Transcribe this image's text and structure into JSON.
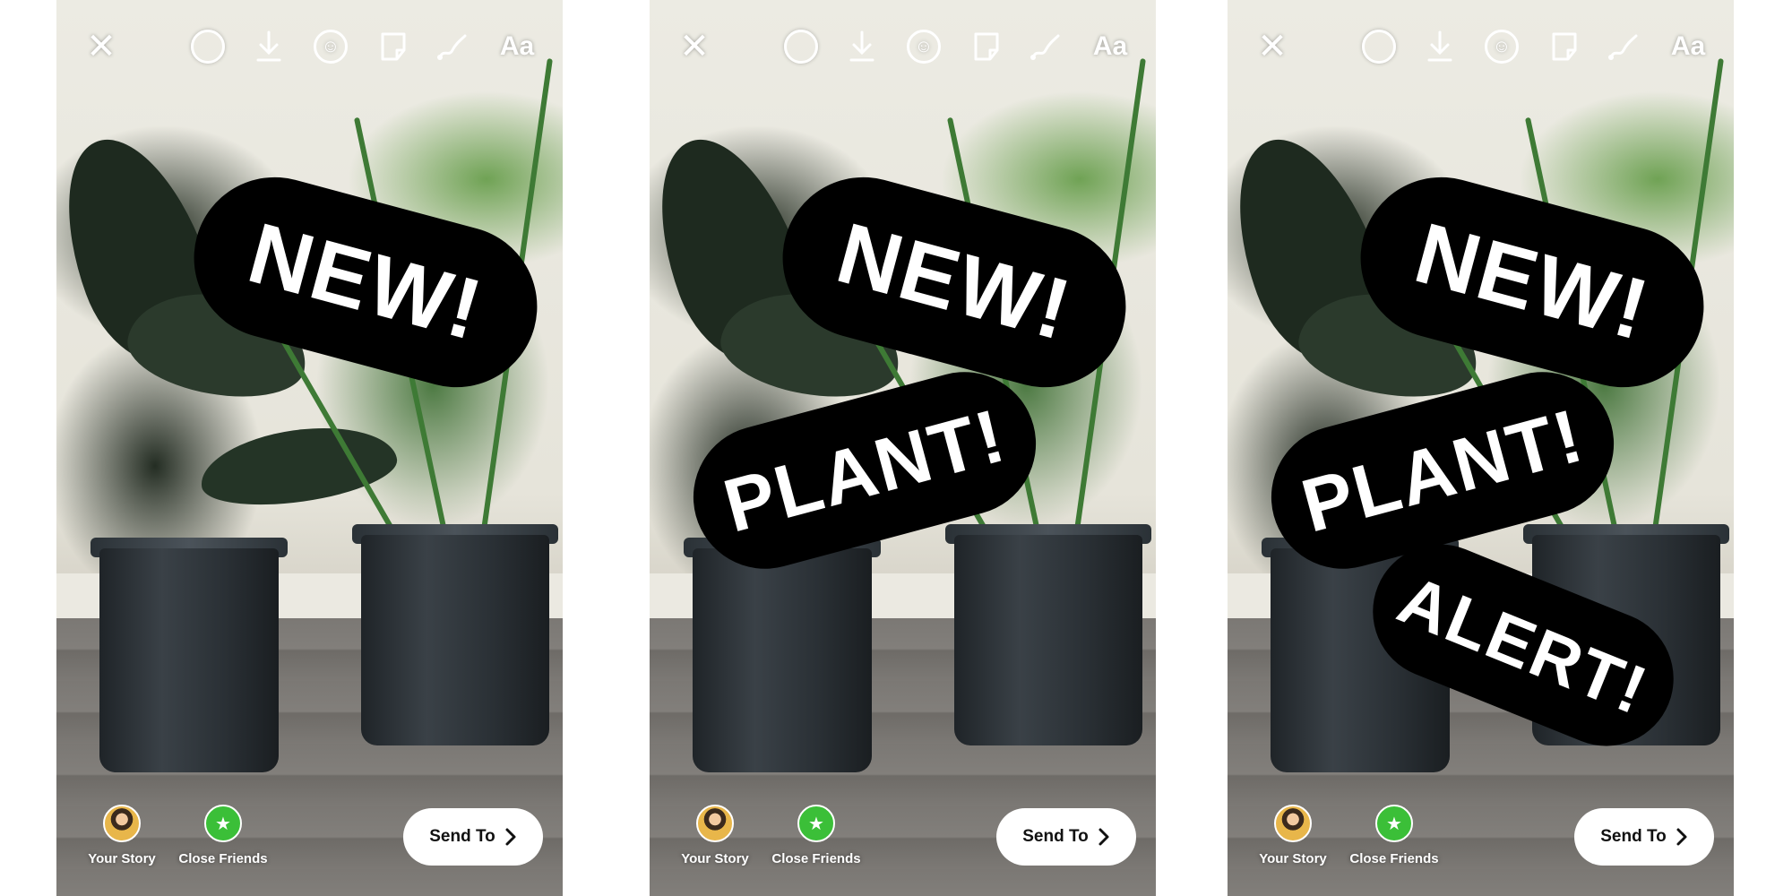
{
  "screens": [
    {
      "toolbar": {
        "text_tool_label": "Aa"
      },
      "stickers": [
        {
          "text": "NEW!"
        }
      ],
      "share": {
        "your_story_label": "Your Story",
        "close_friends_label": "Close Friends",
        "send_label": "Send To"
      }
    },
    {
      "toolbar": {
        "text_tool_label": "Aa"
      },
      "stickers": [
        {
          "text": "NEW!"
        },
        {
          "text": "PLANT!"
        }
      ],
      "share": {
        "your_story_label": "Your Story",
        "close_friends_label": "Close Friends",
        "send_label": "Send To"
      }
    },
    {
      "toolbar": {
        "text_tool_label": "Aa"
      },
      "stickers": [
        {
          "text": "NEW!"
        },
        {
          "text": "PLANT!"
        },
        {
          "text": "ALERT!"
        }
      ],
      "share": {
        "your_story_label": "Your Story",
        "close_friends_label": "Close Friends",
        "send_label": "Send To"
      }
    }
  ],
  "icons": {
    "close": "close-icon",
    "capture_circle": "circle-icon",
    "download": "download-icon",
    "face_sticker": "face-sticker-icon",
    "sticker": "sticker-icon",
    "draw": "draw-icon",
    "chevron": "chevron-right-icon",
    "star": "star-icon"
  },
  "colors": {
    "sticker_bg": "#000000",
    "sticker_text": "#ffffff",
    "close_friends_green": "#3bbf38",
    "send_button_bg": "#ffffff"
  }
}
